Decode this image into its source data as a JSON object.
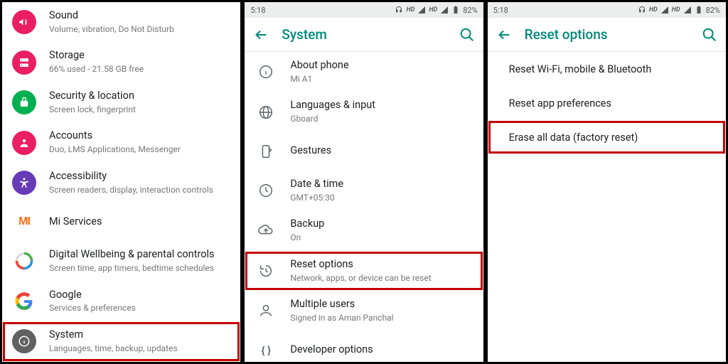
{
  "status": {
    "time": "5:18",
    "battery": "82%",
    "hd": "HD"
  },
  "panel1": {
    "items": [
      {
        "title": "Sound",
        "sub": "Volume, vibration, Do Not Disturb"
      },
      {
        "title": "Storage",
        "sub": "66% used - 21.58 GB free"
      },
      {
        "title": "Security & location",
        "sub": "Screen lock, fingerprint"
      },
      {
        "title": "Accounts",
        "sub": "Duo, LMS Applications, Messenger"
      },
      {
        "title": "Accessibility",
        "sub": "Screen readers, display, interaction controls"
      },
      {
        "title": "Mi Services",
        "sub": ""
      },
      {
        "title": "Digital Wellbeing & parental controls",
        "sub": "Screen time, app timers, bedtime schedules"
      },
      {
        "title": "Google",
        "sub": "Services & preferences"
      },
      {
        "title": "System",
        "sub": "Languages, time, backup, updates"
      }
    ]
  },
  "panel2": {
    "header": "System",
    "items": [
      {
        "title": "About phone",
        "sub": "Mi A1"
      },
      {
        "title": "Languages & input",
        "sub": "Gboard"
      },
      {
        "title": "Gestures",
        "sub": ""
      },
      {
        "title": "Date & time",
        "sub": "GMT+05:30"
      },
      {
        "title": "Backup",
        "sub": "On"
      },
      {
        "title": "Reset options",
        "sub": "Network, apps, or device can be reset"
      },
      {
        "title": "Multiple users",
        "sub": "Signed in as Aman Panchal"
      },
      {
        "title": "Developer options",
        "sub": ""
      }
    ]
  },
  "panel3": {
    "header": "Reset options",
    "items": [
      {
        "title": "Reset Wi-Fi, mobile & Bluetooth"
      },
      {
        "title": "Reset app preferences"
      },
      {
        "title": "Erase all data (factory reset)"
      }
    ]
  }
}
